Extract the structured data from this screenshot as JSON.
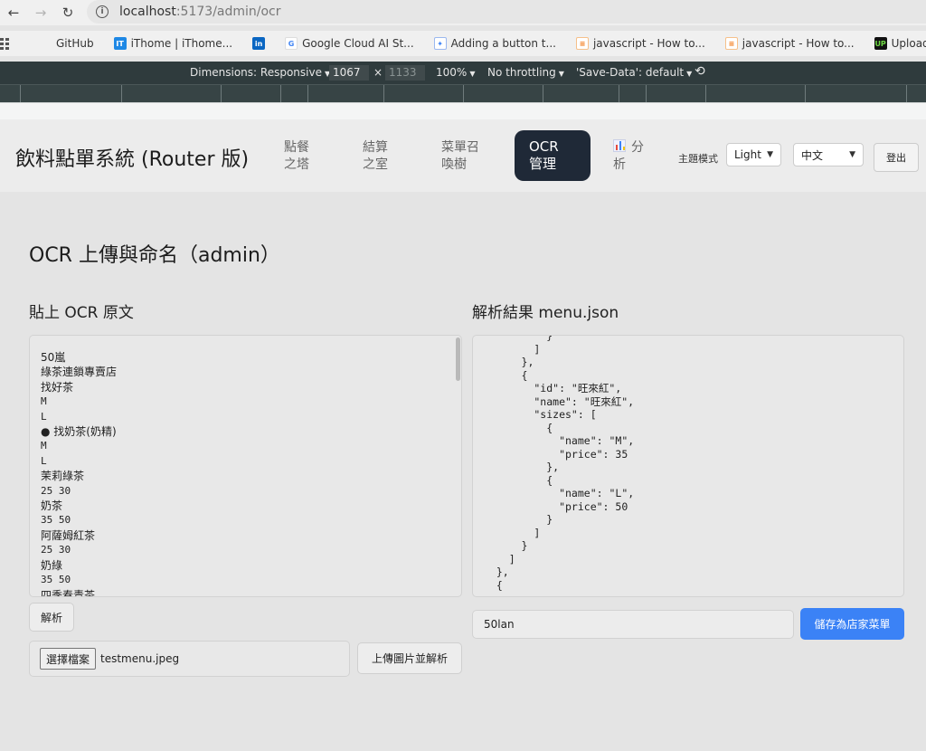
{
  "browser": {
    "url_host": "localhost",
    "url_path": ":5173/admin/ocr"
  },
  "bookmarks": [
    {
      "label": "GitHub",
      "icon": "github-icon"
    },
    {
      "label": "iThome | iThome...",
      "icon": "ithome-icon"
    },
    {
      "label": "",
      "icon": "linkedin-icon"
    },
    {
      "label": "Google Cloud AI St...",
      "icon": "google-icon"
    },
    {
      "label": "Adding a button t...",
      "icon": "gear-badge-icon"
    },
    {
      "label": "javascript - How to...",
      "icon": "stackoverflow-icon"
    },
    {
      "label": "javascript - How to...",
      "icon": "stackoverflow-icon"
    },
    {
      "label": "Uploading Files Wi...",
      "icon": "upwork-icon"
    }
  ],
  "devtools": {
    "dimensions_label": "Dimensions: Responsive",
    "width": "1067",
    "times": "×",
    "height": "1133",
    "zoom": "100%",
    "throttling": "No throttling",
    "save_data": "'Save-Data': default"
  },
  "header": {
    "title": "飲料點單系統 (Router 版)",
    "nav": [
      {
        "line1": "點餐",
        "line2": "之塔"
      },
      {
        "line1": "結算",
        "line2": "之室"
      },
      {
        "line1": "菜單召",
        "line2": "喚樹"
      },
      {
        "line1": "OCR",
        "line2": "管理"
      },
      {
        "line1": "分",
        "line2": "析"
      }
    ],
    "theme_label": "主題模式",
    "theme_value": "Light",
    "lang_value": "中文",
    "logout_label": "登出"
  },
  "main": {
    "page_title": "OCR 上傳與命名（admin）",
    "raw_title": "貼上 OCR 原文",
    "result_title": "解析結果 menu.json",
    "raw_lines": [
      "50嵐",
      "綠茶連鎖專賣店",
      "找好茶",
      "M",
      "L",
      "● 找奶茶(奶精)",
      "M",
      "L",
      "茉莉綠茶",
      "25 30",
      "奶茶",
      "35 50",
      "阿薩姆紅茶",
      "25 30",
      "奶綠",
      "35 50",
      "四季春青茶"
    ],
    "json_text": "          }\n        ]\n      },\n      {\n        \"id\": \"旺來紅\",\n        \"name\": \"旺來紅\",\n        \"sizes\": [\n          {\n            \"name\": \"M\",\n            \"price\": 35\n          },\n          {\n            \"name\": \"L\",\n            \"price\": 50\n          }\n        ]\n      }\n    ]\n  },\n  {",
    "parse_button": "解析",
    "choose_file_button": "選擇檔案",
    "file_name": "testmenu.jpeg",
    "upload_button": "上傳圖片並解析",
    "store_name_value": "50lan",
    "save_button": "儲存為店家菜單"
  },
  "colors": {
    "active_nav": "#1f2937",
    "primary": "#3b82f6",
    "devtools_bar": "#2f3b3d"
  }
}
